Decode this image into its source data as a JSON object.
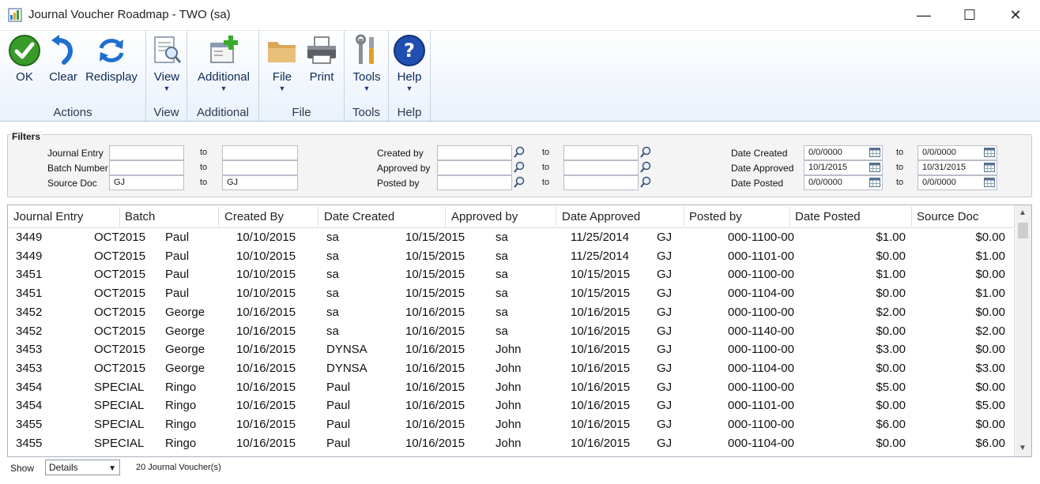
{
  "window": {
    "title": "Journal Voucher Roadmap  -  TWO (sa)",
    "minimize": "—",
    "maximize": "☐",
    "close": "✕"
  },
  "ribbon": {
    "groups": [
      {
        "label": "Actions"
      },
      {
        "label": "View"
      },
      {
        "label": "Additional"
      },
      {
        "label": "File"
      },
      {
        "label": "Tools"
      },
      {
        "label": "Help"
      }
    ],
    "buttons": {
      "ok": "OK",
      "clear": "Clear",
      "redisplay": "Redisplay",
      "view": "View",
      "additional": "Additional",
      "file": "File",
      "print": "Print",
      "tools": "Tools",
      "help": "Help"
    },
    "dropdown_glyph": "▼"
  },
  "filters": {
    "title": "Filters",
    "to": "to",
    "left": [
      {
        "label": "Journal Entry",
        "from": "",
        "to": ""
      },
      {
        "label": "Batch Number",
        "from": "",
        "to": ""
      },
      {
        "label": "Source Doc",
        "from": "GJ",
        "to": "GJ"
      }
    ],
    "middle": [
      {
        "label": "Created by",
        "from": "",
        "to": ""
      },
      {
        "label": "Approved by",
        "from": "",
        "to": ""
      },
      {
        "label": "Posted by",
        "from": "",
        "to": ""
      }
    ],
    "right": [
      {
        "label": "Date Created",
        "from": "0/0/0000",
        "to": "0/0/0000"
      },
      {
        "label": "Date Approved",
        "from": "10/1/2015",
        "to": "10/31/2015"
      },
      {
        "label": "Date Posted",
        "from": "0/0/0000",
        "to": "0/0/0000"
      }
    ]
  },
  "grid": {
    "headers": [
      "Journal Entry",
      "Batch",
      "Created By",
      "Date Created",
      "Approved by",
      "Date Approved",
      "Posted by",
      "Date Posted",
      "Source Doc"
    ],
    "rows": [
      [
        "3449",
        "OCT2015",
        "Paul",
        "10/10/2015",
        "sa",
        "10/15/2015",
        "sa",
        "11/25/2014",
        "GJ",
        "000-1100-00",
        "$1.00",
        "$0.00"
      ],
      [
        "3449",
        "OCT2015",
        "Paul",
        "10/10/2015",
        "sa",
        "10/15/2015",
        "sa",
        "11/25/2014",
        "GJ",
        "000-1101-00",
        "$0.00",
        "$1.00"
      ],
      [
        "3451",
        "OCT2015",
        "Paul",
        "10/10/2015",
        "sa",
        "10/15/2015",
        "sa",
        "10/15/2015",
        "GJ",
        "000-1100-00",
        "$1.00",
        "$0.00"
      ],
      [
        "3451",
        "OCT2015",
        "Paul",
        "10/10/2015",
        "sa",
        "10/15/2015",
        "sa",
        "10/15/2015",
        "GJ",
        "000-1104-00",
        "$0.00",
        "$1.00"
      ],
      [
        "3452",
        "OCT2015",
        "George",
        "10/16/2015",
        "sa",
        "10/16/2015",
        "sa",
        "10/16/2015",
        "GJ",
        "000-1100-00",
        "$2.00",
        "$0.00"
      ],
      [
        "3452",
        "OCT2015",
        "George",
        "10/16/2015",
        "sa",
        "10/16/2015",
        "sa",
        "10/16/2015",
        "GJ",
        "000-1140-00",
        "$0.00",
        "$2.00"
      ],
      [
        "3453",
        "OCT2015",
        "George",
        "10/16/2015",
        "DYNSA",
        "10/16/2015",
        "John",
        "10/16/2015",
        "GJ",
        "000-1100-00",
        "$3.00",
        "$0.00"
      ],
      [
        "3453",
        "OCT2015",
        "George",
        "10/16/2015",
        "DYNSA",
        "10/16/2015",
        "John",
        "10/16/2015",
        "GJ",
        "000-1104-00",
        "$0.00",
        "$3.00"
      ],
      [
        "3454",
        "SPECIAL",
        "Ringo",
        "10/16/2015",
        "Paul",
        "10/16/2015",
        "John",
        "10/16/2015",
        "GJ",
        "000-1100-00",
        "$5.00",
        "$0.00"
      ],
      [
        "3454",
        "SPECIAL",
        "Ringo",
        "10/16/2015",
        "Paul",
        "10/16/2015",
        "John",
        "10/16/2015",
        "GJ",
        "000-1101-00",
        "$0.00",
        "$5.00"
      ],
      [
        "3455",
        "SPECIAL",
        "Ringo",
        "10/16/2015",
        "Paul",
        "10/16/2015",
        "John",
        "10/16/2015",
        "GJ",
        "000-1100-00",
        "$6.00",
        "$0.00"
      ],
      [
        "3455",
        "SPECIAL",
        "Ringo",
        "10/16/2015",
        "Paul",
        "10/16/2015",
        "John",
        "10/16/2015",
        "GJ",
        "000-1104-00",
        "$0.00",
        "$6.00"
      ]
    ]
  },
  "footer": {
    "show_label": "Show",
    "show_value": "Details",
    "count": "20 Journal Voucher(s)"
  },
  "colors": {
    "ribbon_label": "#2b3a4f",
    "ok_green": "#3a9a2a",
    "blue_icon": "#1e6fd0",
    "help_blue": "#1f4fb0"
  }
}
